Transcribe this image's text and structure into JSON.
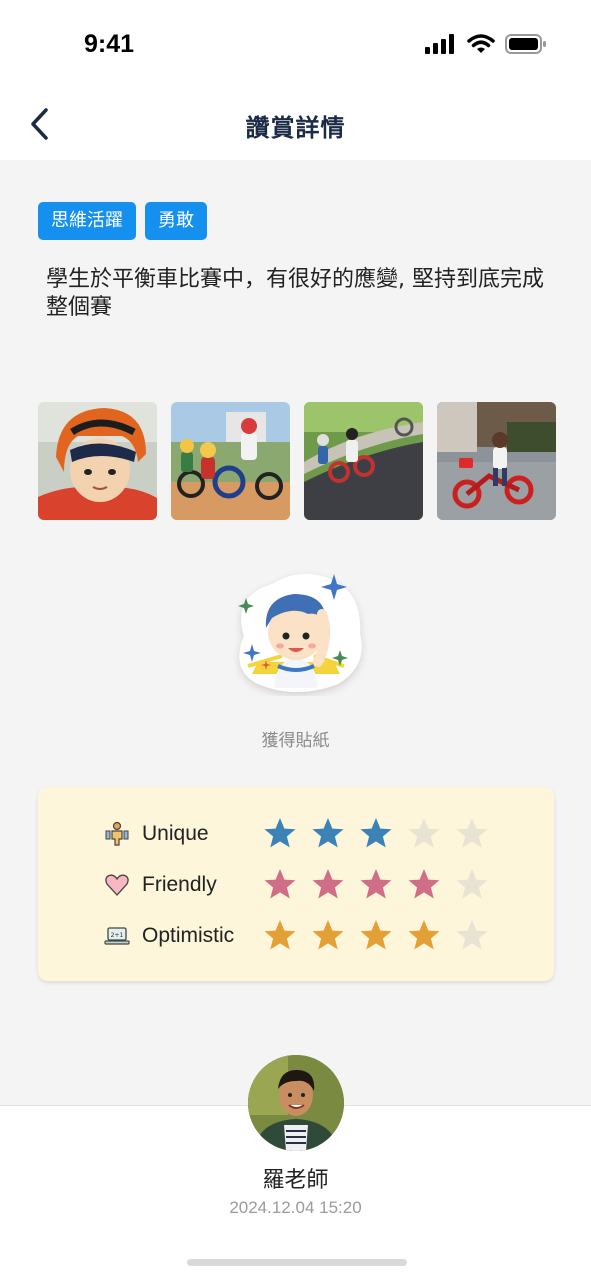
{
  "status_bar": {
    "time": "9:41",
    "icons": [
      "signal-icon",
      "wifi-icon",
      "battery-icon"
    ]
  },
  "nav": {
    "title": "讚賞詳情",
    "back_icon": "chevron-left-icon"
  },
  "tags": [
    {
      "label": "思維活躍"
    },
    {
      "label": "勇敢"
    }
  ],
  "description": "學生於平衡車比賽中，有很好的應變, 堅持到底完成整個賽",
  "photos": [
    {
      "subject": "child-with-orange-helmet"
    },
    {
      "subject": "kids-racing-balance-bikes"
    },
    {
      "subject": "kids-riding-on-track"
    },
    {
      "subject": "child-on-red-balance-bike"
    }
  ],
  "sticker": {
    "caption": "獲得貼紙",
    "icon": "happy-boy-sparkle-sticker"
  },
  "ratings": [
    {
      "label": "Unique",
      "icon": "unique-person-icon",
      "score": 3,
      "max": 5,
      "color": "#3b82b6"
    },
    {
      "label": "Friendly",
      "icon": "heart-icon",
      "score": 4,
      "max": 5,
      "color": "#cf6e86"
    },
    {
      "label": "Optimistic",
      "icon": "laptop-icon",
      "score": 4,
      "max": 5,
      "color": "#e2a035"
    }
  ],
  "colors": {
    "tag_bg": "#1590ef",
    "card_bg": "#fdf6db",
    "empty_star": "#e8e3d2"
  },
  "teacher": {
    "name": "羅老師",
    "timestamp": "2024.12.04 15:20"
  }
}
